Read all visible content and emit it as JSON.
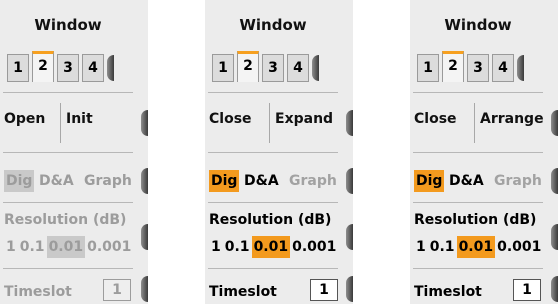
{
  "panels": [
    {
      "title": "Window",
      "tabs": [
        "1",
        "2",
        "3",
        "4"
      ],
      "active_tab": "2",
      "buttons": [
        "Open",
        "Init"
      ],
      "mode": {
        "dig": "Dig",
        "da": "D&A",
        "graph": "Graph"
      },
      "resolution": {
        "label": "Resolution (dB)",
        "values": [
          "1",
          "0.1",
          "0.01",
          "0.001"
        ],
        "selected": "0.01"
      },
      "timeslot": {
        "label": "Timeslot",
        "value": "1"
      },
      "state": "disabled"
    },
    {
      "title": "Window",
      "tabs": [
        "1",
        "2",
        "3",
        "4"
      ],
      "active_tab": "2",
      "buttons": [
        "Close",
        "Expand"
      ],
      "mode": {
        "dig": "Dig",
        "da": "D&A",
        "graph": "Graph"
      },
      "resolution": {
        "label": "Resolution (dB)",
        "values": [
          "1",
          "0.1",
          "0.01",
          "0.001"
        ],
        "selected": "0.01"
      },
      "timeslot": {
        "label": "Timeslot",
        "value": "1"
      },
      "state": "enabled"
    },
    {
      "title": "Window",
      "tabs": [
        "1",
        "2",
        "3",
        "4"
      ],
      "active_tab": "2",
      "buttons": [
        "Close",
        "Arrange"
      ],
      "mode": {
        "dig": "Dig",
        "da": "D&A",
        "graph": "Graph"
      },
      "resolution": {
        "label": "Resolution (dB)",
        "values": [
          "1",
          "0.1",
          "0.01",
          "0.001"
        ],
        "selected": "0.01"
      },
      "timeslot": {
        "label": "Timeslot",
        "value": "1"
      },
      "state": "enabled"
    }
  ],
  "colors": {
    "accent": "#f39a1e",
    "tab_highlight": "#f6a020",
    "panel_bg": "#ececec",
    "disabled_text": "#9c9c9c"
  }
}
